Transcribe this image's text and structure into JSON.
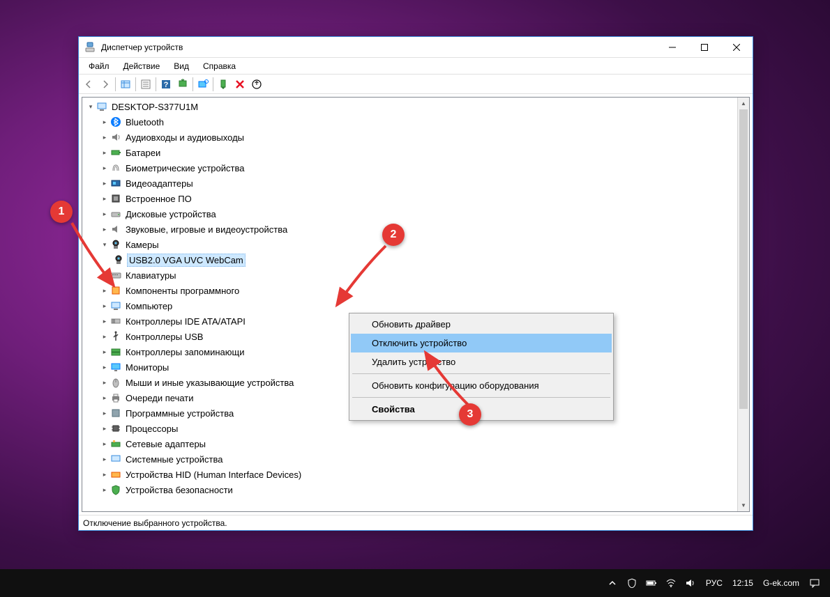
{
  "window": {
    "title": "Диспетчер устройств",
    "statusbar": "Отключение выбранного устройства."
  },
  "menu": {
    "file": "Файл",
    "action": "Действие",
    "view": "Вид",
    "help": "Справка"
  },
  "tree": {
    "root": "DESKTOP-S377U1M",
    "items": [
      "Bluetooth",
      "Аудиовходы и аудиовыходы",
      "Батареи",
      "Биометрические устройства",
      "Видеоадаптеры",
      "Встроенное ПО",
      "Дисковые устройства",
      "Звуковые, игровые и видеоустройства",
      "Камеры",
      "Клавиатуры",
      "Компоненты программного",
      "Компьютер",
      "Контроллеры IDE ATA/ATAPI",
      "Контроллеры USB",
      "Контроллеры запоминающи",
      "Мониторы",
      "Мыши и иные указывающие устройства",
      "Очереди печати",
      "Программные устройства",
      "Процессоры",
      "Сетевые адаптеры",
      "Системные устройства",
      "Устройства HID (Human Interface Devices)",
      "Устройства безопасности"
    ],
    "camera_child": "USB2.0 VGA UVC WebCam"
  },
  "context_menu": {
    "update_driver": "Обновить драйвер",
    "disable": "Отключить устройство",
    "uninstall": "Удалить устройство",
    "scan": "Обновить конфигурацию оборудования",
    "properties": "Свойства"
  },
  "callouts": {
    "c1": "1",
    "c2": "2",
    "c3": "3"
  },
  "taskbar": {
    "lang": "РУС",
    "time": "12:15",
    "site": "G-ek.com"
  }
}
